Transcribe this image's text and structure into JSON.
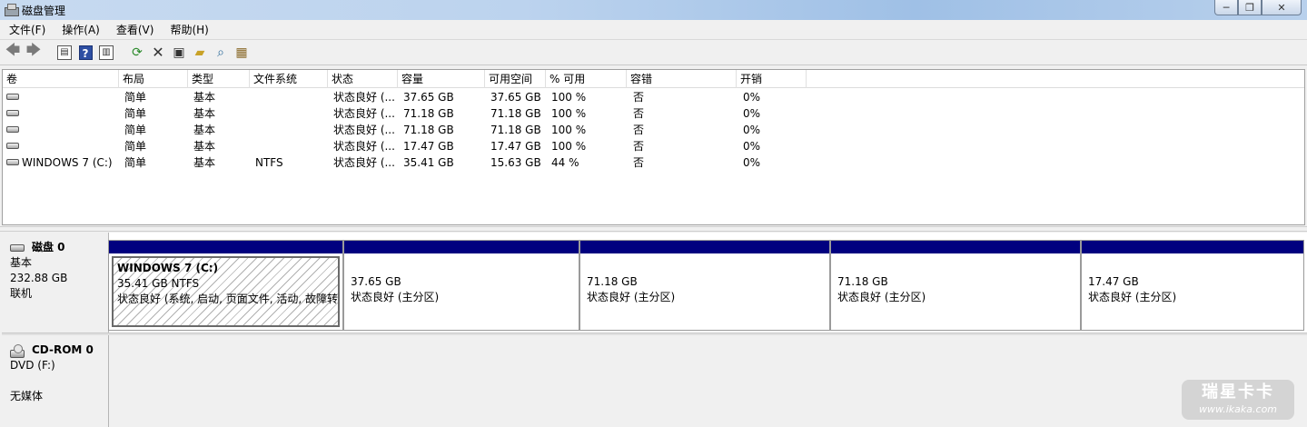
{
  "window": {
    "title": "磁盘管理",
    "minimize": "─",
    "maximize": "❐",
    "close": "✕"
  },
  "menu": [
    "文件(F)",
    "操作(A)",
    "查看(V)",
    "帮助(H)"
  ],
  "toolbar": {
    "icons": [
      "back-icon",
      "forward-icon",
      "show-hide-console-tree-icon",
      "help-icon",
      "show-hide-action-pane-icon",
      "refresh-icon",
      "delete-icon",
      "properties-icon",
      "open-icon",
      "explore-icon",
      "export-list-icon"
    ]
  },
  "volume_table": {
    "columns": [
      "卷",
      "布局",
      "类型",
      "文件系统",
      "状态",
      "容量",
      "可用空间",
      "% 可用",
      "容错",
      "开销"
    ],
    "rows": [
      {
        "volume": "",
        "layout": "简单",
        "type": "基本",
        "fs": "",
        "status": "状态良好 (...",
        "capacity": "37.65 GB",
        "free": "37.65 GB",
        "pct": "100 %",
        "fault": "否",
        "overhead": "0%"
      },
      {
        "volume": "",
        "layout": "简单",
        "type": "基本",
        "fs": "",
        "status": "状态良好 (...",
        "capacity": "71.18 GB",
        "free": "71.18 GB",
        "pct": "100 %",
        "fault": "否",
        "overhead": "0%"
      },
      {
        "volume": "",
        "layout": "简单",
        "type": "基本",
        "fs": "",
        "status": "状态良好 (...",
        "capacity": "71.18 GB",
        "free": "71.18 GB",
        "pct": "100 %",
        "fault": "否",
        "overhead": "0%"
      },
      {
        "volume": "",
        "layout": "简单",
        "type": "基本",
        "fs": "",
        "status": "状态良好 (...",
        "capacity": "17.47 GB",
        "free": "17.47 GB",
        "pct": "100 %",
        "fault": "否",
        "overhead": "0%"
      },
      {
        "volume": "WINDOWS 7 (C:)",
        "layout": "简单",
        "type": "基本",
        "fs": "NTFS",
        "status": "状态良好 (...",
        "capacity": "35.41 GB",
        "free": "15.63 GB",
        "pct": "44 %",
        "fault": "否",
        "overhead": "0%"
      }
    ]
  },
  "disk0": {
    "name": "磁盘 0",
    "type": "基本",
    "size": "232.88 GB",
    "state": "联机",
    "partitions": [
      {
        "name": "WINDOWS 7  (C:)",
        "size": "35.41 GB NTFS",
        "status": "状态良好 (系统, 启动, 页面文件, 活动, 故障转储, 主分区)"
      },
      {
        "name": "",
        "size": "37.65 GB",
        "status": "状态良好 (主分区)"
      },
      {
        "name": "",
        "size": "71.18 GB",
        "status": "状态良好 (主分区)"
      },
      {
        "name": "",
        "size": "71.18 GB",
        "status": "状态良好 (主分区)"
      },
      {
        "name": "",
        "size": "17.47 GB",
        "status": "状态良好 (主分区)"
      }
    ]
  },
  "cdrom0": {
    "name": "CD-ROM 0",
    "drive": "DVD (F:)",
    "media": "无媒体"
  },
  "watermark": {
    "line1": "瑞星卡卡",
    "line2": "www.ikaka.com"
  }
}
